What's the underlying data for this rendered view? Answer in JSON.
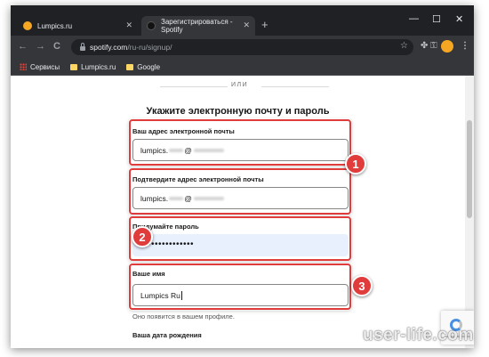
{
  "browser": {
    "tabs": [
      {
        "title": "Lumpics.ru"
      },
      {
        "title": "Зарегистрироваться - Spotify"
      }
    ],
    "address": {
      "host": "spotify.com",
      "path": "/ru-ru/signup/"
    },
    "bookmarks": [
      {
        "label": "Сервисы"
      },
      {
        "label": "Lumpics.ru"
      },
      {
        "label": "Google"
      }
    ],
    "icons": {
      "back": "←",
      "forward": "→",
      "reload": "C",
      "minimize": "—",
      "maximize": "☐",
      "close": "✕",
      "tab_close": "✕",
      "new_tab": "+",
      "star": "☆",
      "extensions": "✤",
      "key": "⚿",
      "menu": "⋮"
    }
  },
  "page": {
    "or_text": "ИЛИ",
    "heading": "Укажите электронную почту и пароль",
    "email": {
      "label": "Ваш адрес электронной почты",
      "value_start": "lumpics.",
      "value_at": "@"
    },
    "confirm_email": {
      "label": "Подтвердите адрес электронной почты",
      "value_start": "lumpics.",
      "value_at": "@"
    },
    "password": {
      "label": "Придумайте пароль",
      "value": "•••••••••••••••"
    },
    "name": {
      "label": "Ваше имя",
      "value": "Lumpics Ru"
    },
    "name_hint": "Оно появится в вашем профиле.",
    "dob_label": "Ваша дата рождения"
  },
  "annotations": {
    "badge1": "1",
    "badge2": "2",
    "badge3": "3",
    "highlight_color": "#e03c3c"
  },
  "watermark": "user-life.com"
}
